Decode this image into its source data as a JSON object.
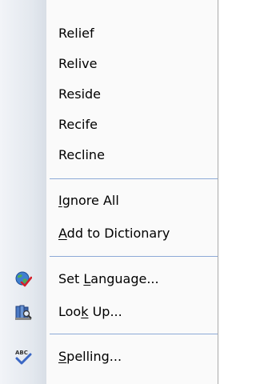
{
  "menu": {
    "suggestions": [
      {
        "label": "Relief"
      },
      {
        "label": "Relive"
      },
      {
        "label": "Reside"
      },
      {
        "label": "Recife"
      },
      {
        "label": "Recline"
      }
    ],
    "ignore_all": {
      "pre": "",
      "key": "I",
      "post": "gnore All"
    },
    "add_to_dictionary": {
      "pre": "",
      "key": "A",
      "post": "dd to Dictionary"
    },
    "set_language": {
      "pre": "Set ",
      "key": "L",
      "post": "anguage...",
      "icon": "globe-check-icon"
    },
    "look_up": {
      "pre": "Loo",
      "key": "k",
      "post": " Up...",
      "icon": "research-book-icon"
    },
    "spelling": {
      "pre": "",
      "key": "S",
      "post": "pelling...",
      "icon": "abc-check-icon"
    },
    "colors": {
      "separator": "#8da9d6",
      "gutter": "#e3e8ee"
    }
  }
}
